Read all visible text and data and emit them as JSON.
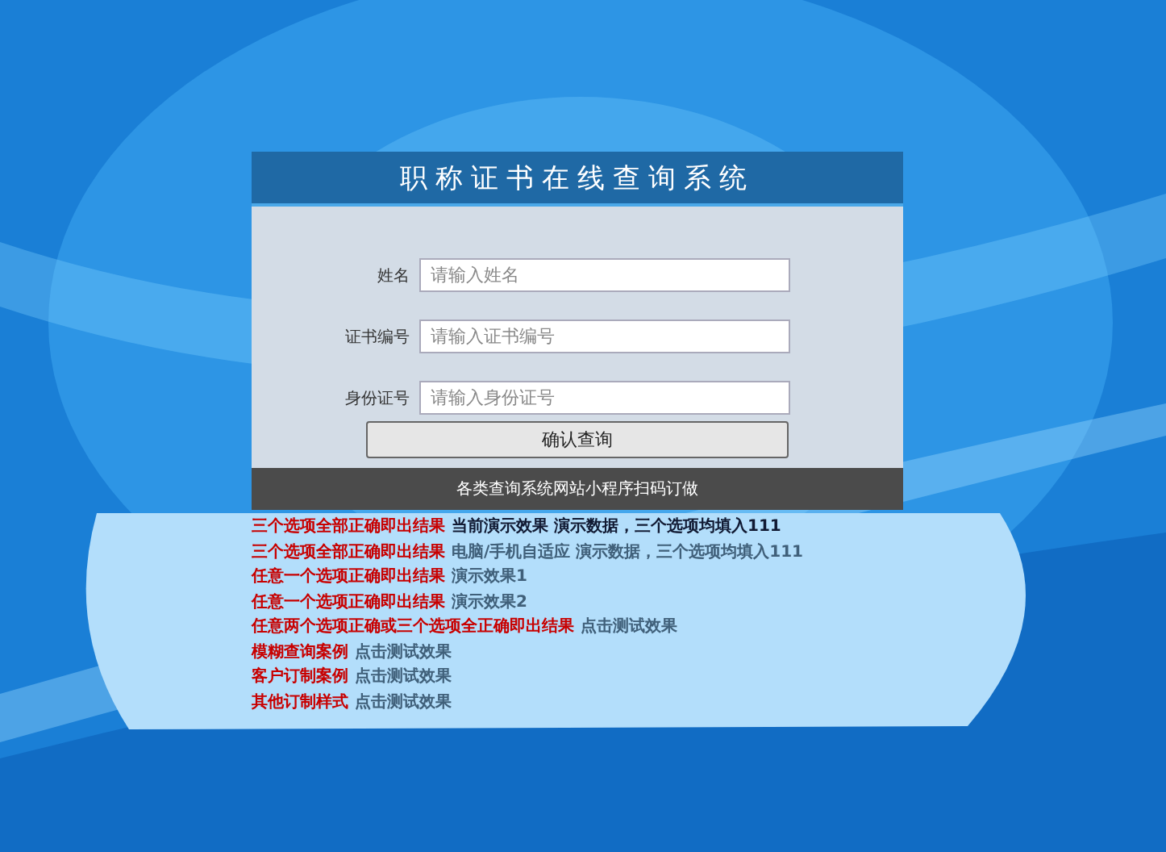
{
  "title": "职称证书在线查询系统",
  "fields": [
    {
      "label": "姓名",
      "placeholder": "请输入姓名"
    },
    {
      "label": "证书编号",
      "placeholder": "请输入证书编号"
    },
    {
      "label": "身份证号",
      "placeholder": "请输入身份证号"
    }
  ],
  "submit_button": "确认查询",
  "footer": "各类查询系统网站小程序扫码订做",
  "demo_links": [
    {
      "label": "三个选项全部正确即出结果",
      "link": "当前演示效果 演示数据，三个选项均填入111",
      "current": true
    },
    {
      "label": "三个选项全部正确即出结果",
      "link": "电脑/手机自适应 演示数据，三个选项均填入111",
      "current": false
    },
    {
      "label": "任意一个选项正确即出结果",
      "link": "演示效果1",
      "current": false
    },
    {
      "label": "任意一个选项正确即出结果",
      "link": "演示效果2",
      "current": false
    },
    {
      "label": "任意两个选项正确或三个选项全正确即出结果",
      "link": "点击测试效果",
      "current": false
    },
    {
      "label": "模糊查询案例",
      "link": "点击测试效果",
      "current": false
    },
    {
      "label": "客户订制案例",
      "link": "点击测试效果",
      "current": false
    },
    {
      "label": "其他订制样式",
      "link": "点击测试效果",
      "current": false
    }
  ]
}
